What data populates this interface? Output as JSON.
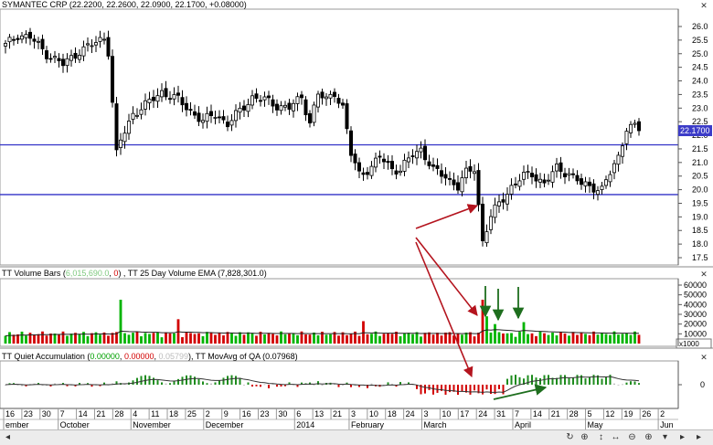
{
  "price_panel": {
    "title": "SYMANTEC CRP (22.2200, 22.2600, 22.0900, 22.1700, +0.08000)",
    "last_price": "22.1700",
    "y_ticks": [
      "26.0",
      "25.5",
      "25.0",
      "24.5",
      "24.0",
      "23.5",
      "23.0",
      "22.5",
      "22.0",
      "21.5",
      "21.0",
      "20.5",
      "20.0",
      "19.5",
      "19.0",
      "18.5",
      "18.0",
      "17.5"
    ],
    "hlines": [
      21.65,
      19.82
    ]
  },
  "volume_panel": {
    "title_a": "TT Volume Bars (",
    "val1": "6,015,690.0",
    "sep": ", ",
    "val2": "0",
    "title_b": ") , TT 25 Day Volume EMA (7,828,301.0)",
    "y_ticks": [
      "60000",
      "50000",
      "40000",
      "30000",
      "20000",
      "10000"
    ],
    "scale_label": "x1000"
  },
  "qa_panel": {
    "title_a": "TT Quiet Accumulation (",
    "val1": "0.00000",
    "sep1": ", ",
    "val2": "0.00000",
    "sep2": ", ",
    "val3": "0.05799",
    "title_b": "), TT MovAvg of QA (0.07968)",
    "y_tick": "0"
  },
  "x_axis": {
    "days": [
      "16",
      "23",
      "30",
      "7",
      "14",
      "21",
      "28",
      "4",
      "11",
      "18",
      "25",
      "2",
      "9",
      "16",
      "23",
      "30",
      "6",
      "13",
      "21",
      "3",
      "10",
      "18",
      "24",
      "3",
      "10",
      "17",
      "24",
      "31",
      "7",
      "14",
      "21",
      "28",
      "5",
      "12",
      "19",
      "26",
      "2"
    ],
    "months": [
      "ember",
      "October",
      "November",
      "December",
      "2014",
      "February",
      "March",
      "April",
      "May",
      "Jun"
    ]
  },
  "colors": {
    "up": "#00b400",
    "down": "#d20000",
    "hline": "#3232c8",
    "ema": "#222222",
    "arrow_red": "#b4141e",
    "arrow_green": "#1e6e1e"
  },
  "chart_data": {
    "type": "candlestick",
    "symbol": "SYMANTEC CRP",
    "period": "Sept 2013 – May 2014 (daily)",
    "anchors": [
      [
        0,
        25.3
      ],
      [
        3,
        25.7
      ],
      [
        6,
        25.6
      ],
      [
        10,
        25.0
      ],
      [
        14,
        24.6
      ],
      [
        18,
        25.1
      ],
      [
        22,
        25.4
      ],
      [
        24,
        25.6
      ],
      [
        25,
        25.1
      ],
      [
        27,
        21.3
      ],
      [
        28,
        21.8
      ],
      [
        31,
        22.8
      ],
      [
        34,
        23.1
      ],
      [
        38,
        23.6
      ],
      [
        42,
        23.3
      ],
      [
        45,
        22.9
      ],
      [
        48,
        22.5
      ],
      [
        51,
        22.8
      ],
      [
        54,
        22.4
      ],
      [
        57,
        22.9
      ],
      [
        60,
        23.4
      ],
      [
        63,
        23.3
      ],
      [
        66,
        23.1
      ],
      [
        69,
        23.0
      ],
      [
        72,
        23.4
      ],
      [
        74,
        22.5
      ],
      [
        76,
        23.5
      ],
      [
        78,
        23.3
      ],
      [
        80,
        23.6
      ],
      [
        82,
        23.0
      ],
      [
        84,
        21.3
      ],
      [
        86,
        20.6
      ],
      [
        89,
        20.8
      ],
      [
        91,
        21.2
      ],
      [
        94,
        20.8
      ],
      [
        96,
        20.7
      ],
      [
        99,
        21.3
      ],
      [
        101,
        21.5
      ],
      [
        104,
        20.7
      ],
      [
        107,
        20.5
      ],
      [
        110,
        20.1
      ],
      [
        112,
        20.6
      ],
      [
        114,
        20.8
      ],
      [
        116,
        18.1
      ],
      [
        118,
        19.0
      ],
      [
        120,
        19.5
      ],
      [
        123,
        20.1
      ],
      [
        126,
        20.5
      ],
      [
        128,
        20.6
      ],
      [
        131,
        20.2
      ],
      [
        134,
        20.8
      ],
      [
        137,
        20.6
      ],
      [
        140,
        20.2
      ],
      [
        143,
        20.1
      ],
      [
        145,
        20.0
      ],
      [
        147,
        20.6
      ],
      [
        149,
        21.2
      ],
      [
        151,
        22.3
      ],
      [
        153,
        22.3
      ],
      [
        154,
        22.17
      ]
    ],
    "volume_spikes_x1000": {
      "28": 45000,
      "42": 25000,
      "87": 23000,
      "116": 45000,
      "117": 28000,
      "119": 20000,
      "126": 22000
    },
    "annotations": [
      "Red arrows point from price panel to volume spikes and Quiet Accumulation dip in late March",
      "Green arrows mark volume bars and the rising QA moving average into April"
    ]
  }
}
